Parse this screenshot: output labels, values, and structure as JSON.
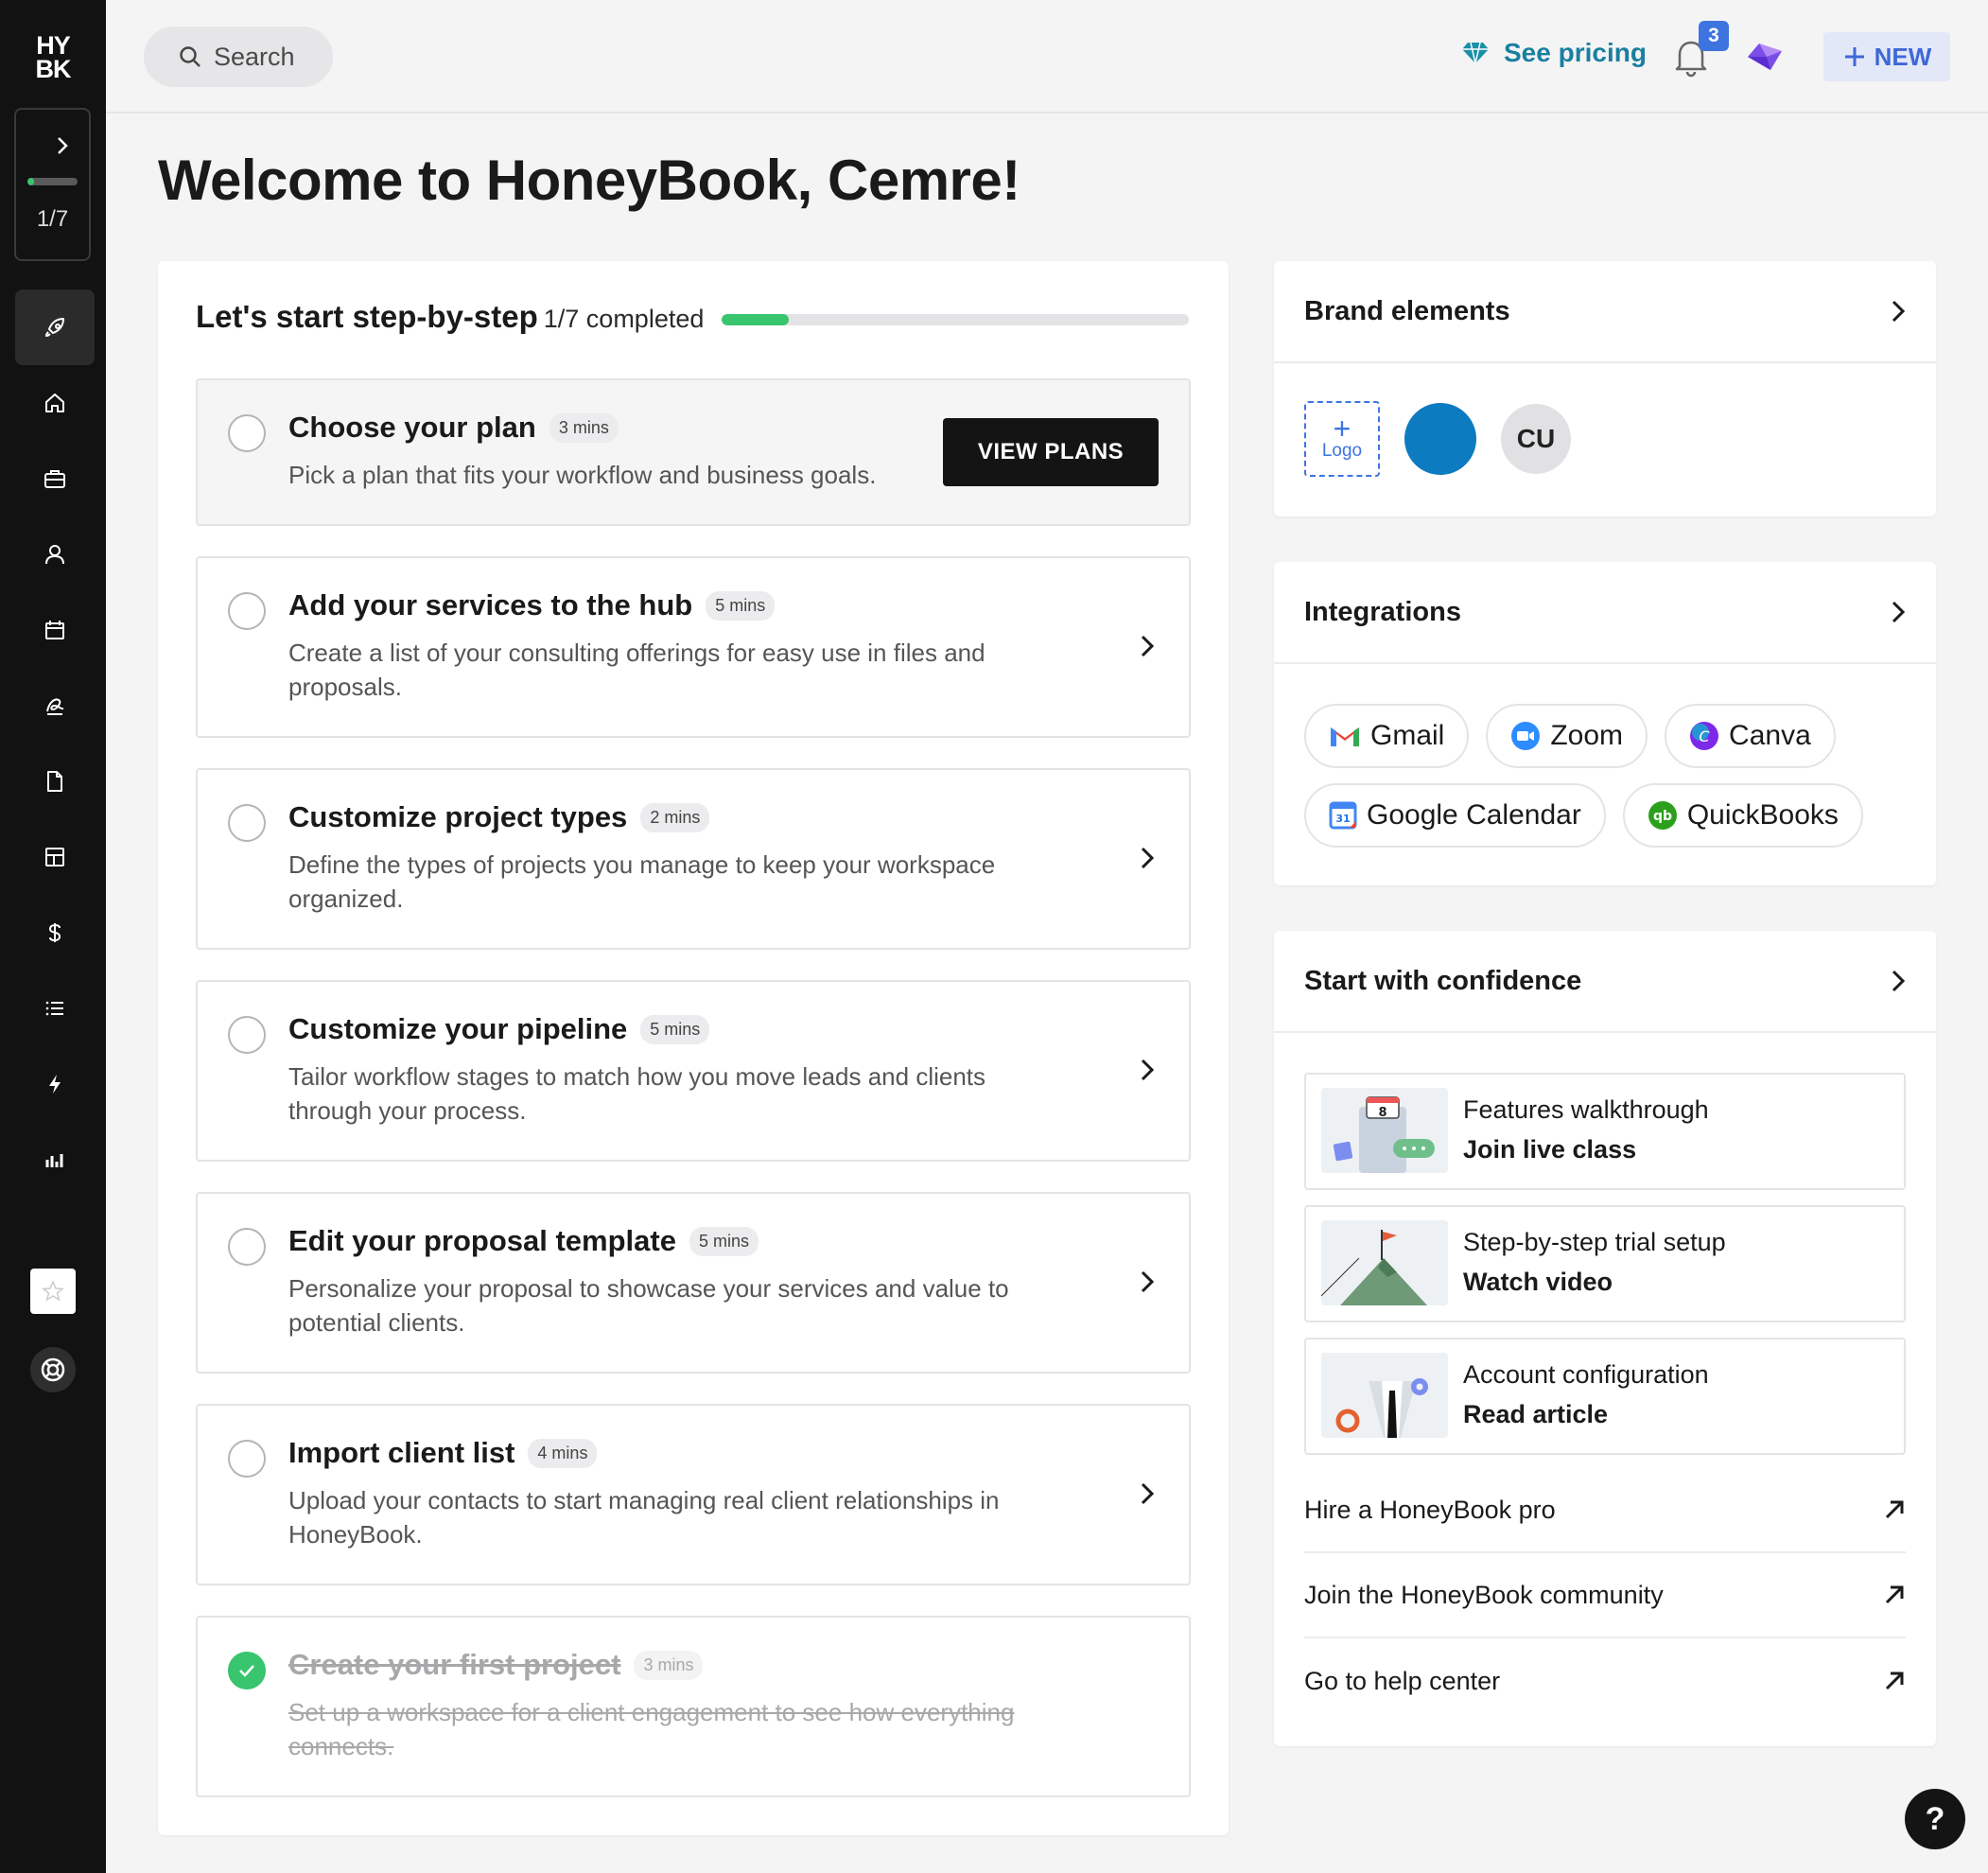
{
  "sidebar": {
    "logo_top": "HY",
    "logo_bottom": "BK",
    "progress_label": "1/7",
    "progress_fraction": 0.14,
    "nav_icons": [
      "rocket-icon",
      "home-icon",
      "briefcase-icon",
      "person-icon",
      "calendar-icon",
      "signature-icon",
      "file-icon",
      "template-icon",
      "dollar-icon",
      "list-icon",
      "lightning-icon",
      "chart-icon"
    ]
  },
  "topbar": {
    "search_label": "Search",
    "pricing_label": "See pricing",
    "notification_count": "3",
    "new_label": "NEW"
  },
  "page_title": "Welcome to HoneyBook, Cemre!",
  "steps": {
    "title": "Let's start step-by-step",
    "completed_label": "1/7 completed",
    "progress_fraction": 0.143,
    "items": [
      {
        "title": "Choose your plan",
        "time": "3 mins",
        "desc": "Pick a plan that fits your workflow and business goals.",
        "button": "VIEW PLANS"
      },
      {
        "title": "Add your services to the hub",
        "time": "5 mins",
        "desc": "Create a list of your consulting offerings for easy use in files and proposals."
      },
      {
        "title": "Customize project types",
        "time": "2 mins",
        "desc": "Define the types of projects you manage to keep your workspace organized."
      },
      {
        "title": "Customize your pipeline",
        "time": "5 mins",
        "desc": "Tailor workflow stages to match how you move leads and clients through your process."
      },
      {
        "title": "Edit your proposal template",
        "time": "5 mins",
        "desc": "Personalize your proposal to showcase your services and value to potential clients."
      },
      {
        "title": "Import client list",
        "time": "4 mins",
        "desc": "Upload your contacts to start managing real client relationships in HoneyBook."
      },
      {
        "title": "Create your first project",
        "time": "3 mins",
        "desc": "Set up a workspace for a client engagement to see how everything connects.",
        "completed": true
      }
    ]
  },
  "brand": {
    "title": "Brand elements",
    "logo_label": "Logo",
    "brand_color": "#0d7bbf",
    "initials": "CU"
  },
  "integrations": {
    "title": "Integrations",
    "items": [
      "Gmail",
      "Zoom",
      "Canva",
      "Google Calendar",
      "QuickBooks"
    ]
  },
  "confidence": {
    "title": "Start with confidence",
    "resources": [
      {
        "line1": "Features walkthrough",
        "line2": "Join live class"
      },
      {
        "line1": "Step-by-step trial setup",
        "line2": "Watch video"
      },
      {
        "line1": "Account configuration",
        "line2": "Read article"
      }
    ],
    "links": [
      "Hire a HoneyBook pro",
      "Join the HoneyBook community",
      "Go to help center"
    ],
    "calendar_day": "8"
  },
  "help_fab": "?",
  "colors": {
    "accent_green": "#39c46e",
    "accent_blue": "#3e74e0",
    "pricing_teal": "#1a7fa0"
  }
}
